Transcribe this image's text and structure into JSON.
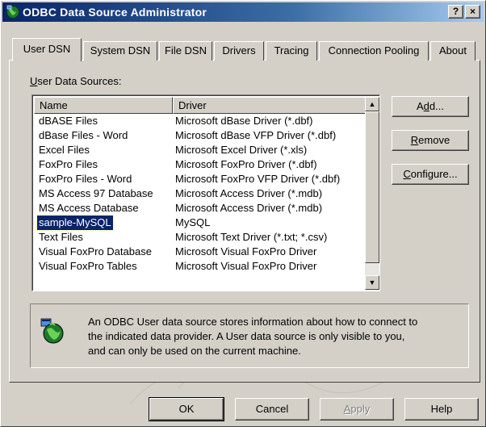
{
  "window": {
    "title": "ODBC Data Source Administrator",
    "help_glyph": "?",
    "close_glyph": "×",
    "icon": "odbc-globe-icon",
    "title_bar_color": "#0a246a",
    "face_color": "#d4d0c8"
  },
  "tabs": [
    {
      "label": "User DSN",
      "active": true
    },
    {
      "label": "System DSN",
      "active": false
    },
    {
      "label": "File DSN",
      "active": false
    },
    {
      "label": "Drivers",
      "active": false
    },
    {
      "label": "Tracing",
      "active": false
    },
    {
      "label": "Connection Pooling",
      "active": false
    },
    {
      "label": "About",
      "active": false
    }
  ],
  "user_dsn": {
    "section_label_accel": "U",
    "section_label_rest": "ser Data Sources:",
    "columns": [
      "Name",
      "Driver"
    ],
    "rows": [
      {
        "name": "dBASE Files",
        "driver": "Microsoft dBase Driver (*.dbf)"
      },
      {
        "name": "dBase Files - Word",
        "driver": "Microsoft dBase VFP Driver (*.dbf)"
      },
      {
        "name": "Excel Files",
        "driver": "Microsoft Excel Driver (*.xls)"
      },
      {
        "name": "FoxPro Files",
        "driver": "Microsoft FoxPro Driver (*.dbf)"
      },
      {
        "name": "FoxPro Files - Word",
        "driver": "Microsoft FoxPro VFP Driver (*.dbf)"
      },
      {
        "name": "MS Access 97 Database",
        "driver": "Microsoft Access Driver (*.mdb)"
      },
      {
        "name": "MS Access Database",
        "driver": "Microsoft Access Driver (*.mdb)"
      },
      {
        "name": "sample-MySQL",
        "driver": "MySQL",
        "selected": true
      },
      {
        "name": "Text Files",
        "driver": "Microsoft Text Driver (*.txt; *.csv)"
      },
      {
        "name": "Visual FoxPro Database",
        "driver": "Microsoft Visual FoxPro Driver"
      },
      {
        "name": "Visual FoxPro Tables",
        "driver": "Microsoft Visual FoxPro Driver"
      }
    ],
    "selection_color": "#0a246a",
    "buttons": {
      "add_pre": "A",
      "add_accel": "d",
      "add_post": "d...",
      "remove_accel": "R",
      "remove_post": "emove",
      "configure_accel": "C",
      "configure_post": "onfigure..."
    },
    "info_icon": "odbc-globe-icon",
    "info_text_line1": "An ODBC User data source stores information about how to connect to",
    "info_text_line2": "the indicated data provider.  A User data source is only visible to you,",
    "info_text_line3": "and can only be used on the current machine."
  },
  "footer": {
    "ok": "OK",
    "cancel": "Cancel",
    "apply_accel": "A",
    "apply_post": "pply",
    "apply_disabled": true,
    "help": "Help"
  }
}
